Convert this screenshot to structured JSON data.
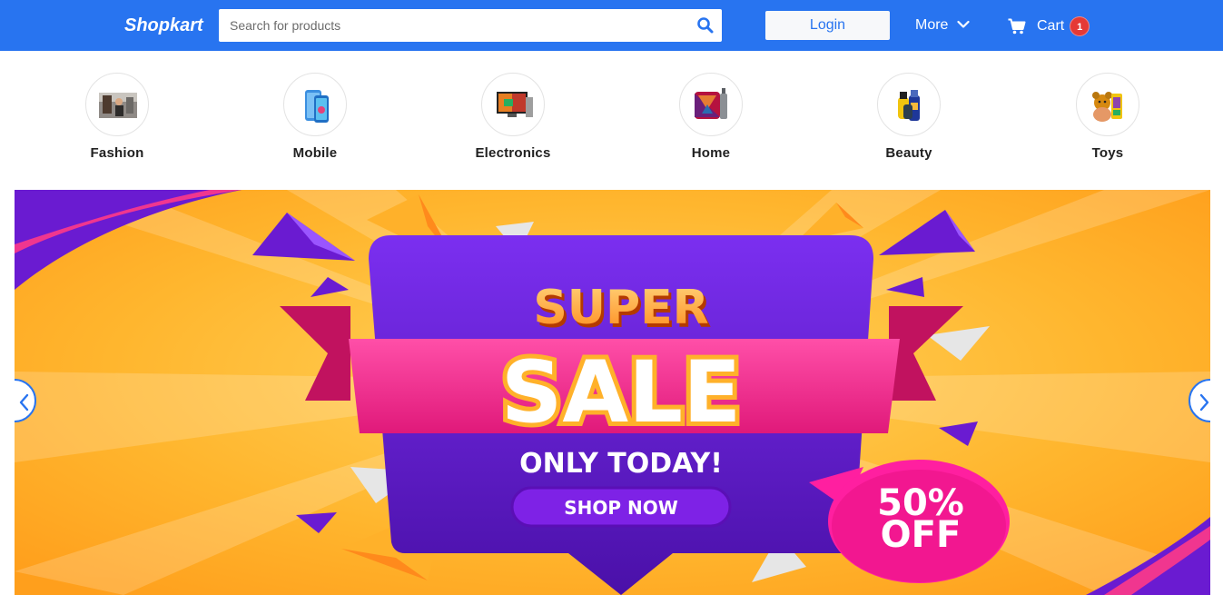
{
  "header": {
    "logo": "Shopkart",
    "search": {
      "placeholder": "Search for products",
      "value": ""
    },
    "login_label": "Login",
    "more_label": "More",
    "cart_label": "Cart",
    "cart_count": "1",
    "background_color": "#2874f0"
  },
  "categories": [
    {
      "label": "Fashion",
      "icon": "fashion-icon"
    },
    {
      "label": "Mobile",
      "icon": "mobile-icon"
    },
    {
      "label": "Electronics",
      "icon": "electronics-icon"
    },
    {
      "label": "Home",
      "icon": "home-icon"
    },
    {
      "label": "Beauty",
      "icon": "beauty-icon"
    },
    {
      "label": "Toys",
      "icon": "toys-icon"
    }
  ],
  "banner": {
    "line1": "SUPER",
    "line2": "SALE",
    "line3": "ONLY TODAY!",
    "cta": "SHOP NOW",
    "discount_line1": "50%",
    "discount_line2": "OFF",
    "colors": {
      "background": "#ffb12a",
      "purple": "#6a1bd1",
      "pink": "#f0368f"
    }
  }
}
